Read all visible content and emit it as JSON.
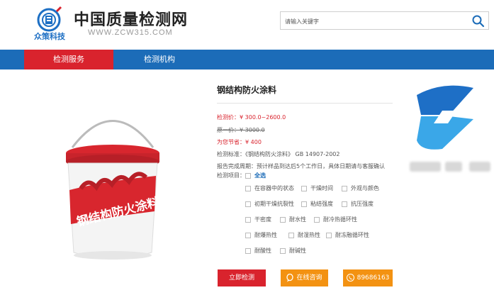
{
  "header": {
    "brand_sub": "众策科技",
    "site_name": "中国质量检测网",
    "site_url": "WWW.ZCW315.COM",
    "search_placeholder": "请输入关键字"
  },
  "nav": {
    "items": [
      {
        "label": "检测服务",
        "active": true
      },
      {
        "label": "检测机构",
        "active": false
      }
    ]
  },
  "product": {
    "image_label": "钢结构防火涂料",
    "title": "钢结构防火涂料",
    "price_label": "检测价：",
    "price_value": "¥ 300.0~2600.0",
    "original_label": "原一价：",
    "original_value": "¥ 3000.0",
    "saving_label": "为您节省：",
    "saving_value": "¥ 400",
    "standard_label": "检测标准：",
    "standard_value": "《钢结构防火涂料》 GB 14907-2002",
    "report_label": "报告完成周期：",
    "report_value": "预计样品到达后5个工作日，具体日期请与客服确认",
    "items_label": "检测项目：",
    "select_all": "全选",
    "options": [
      [
        "在容器中的状态",
        "干燥时间",
        "外观与颜色"
      ],
      [
        "初期干燥抗裂性",
        "粘结强度",
        "抗压强度"
      ],
      [
        "干密度",
        "耐水性",
        "耐冷热循环性"
      ],
      [
        "耐爆热性",
        "耐湿热性",
        "耐冻融循环性"
      ],
      [
        "耐酸性",
        "耐碱性"
      ]
    ]
  },
  "buttons": {
    "detect": "立即检测",
    "consult": "在线咨询",
    "phone": "89686163"
  },
  "colors": {
    "brand_blue": "#1c6cb8",
    "accent_red": "#d9232d",
    "accent_orange": "#f39212"
  }
}
